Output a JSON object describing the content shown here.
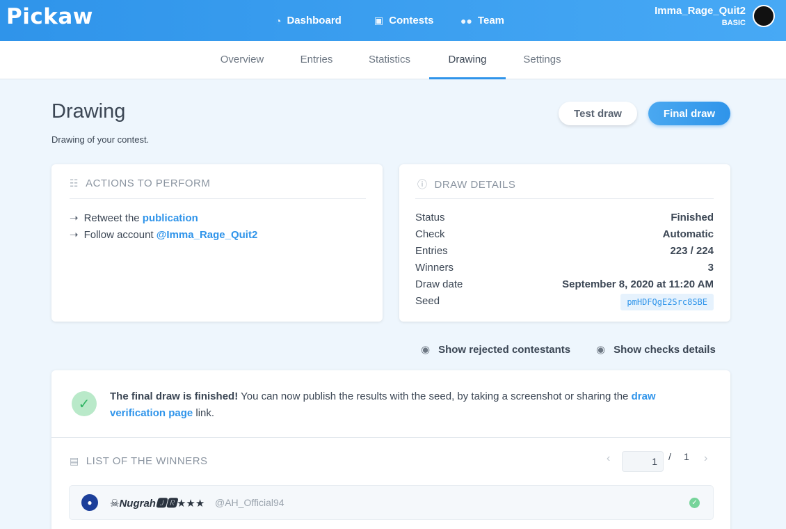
{
  "app": {
    "logo_text": "Pickaw",
    "nav": [
      {
        "label": "Dashboard",
        "icon": "dashboard-icon"
      },
      {
        "label": "Contests",
        "icon": "gift-icon"
      },
      {
        "label": "Team",
        "icon": "team-icon"
      }
    ],
    "user": {
      "name": "Imma_Rage_Quit2",
      "plan": "BASIC"
    }
  },
  "tabs": [
    "Overview",
    "Entries",
    "Statistics",
    "Drawing",
    "Settings"
  ],
  "active_tab": "Drawing",
  "page": {
    "title": "Drawing",
    "subtitle": "Drawing of your contest.",
    "test_draw": "Test draw",
    "final_draw": "Final draw"
  },
  "actions": {
    "title": "ACTIONS TO PERFORM",
    "items": [
      {
        "text": "Retweet the ",
        "link": "publication"
      },
      {
        "text": "Follow account ",
        "link": "@Imma_Rage_Quit2"
      }
    ]
  },
  "details": {
    "title": "DRAW DETAILS",
    "rows": [
      {
        "label": "Status",
        "value": "Finished"
      },
      {
        "label": "Check",
        "value": "Automatic"
      },
      {
        "label": "Entries",
        "value": "223 / 224"
      },
      {
        "label": "Winners",
        "value": "3"
      },
      {
        "label": "Draw date",
        "value": "September 8, 2020 at 11:20 AM"
      },
      {
        "label": "Seed",
        "value": "pmHDFQgE2Src8SBE"
      }
    ]
  },
  "toggles": {
    "rejected": "Show rejected contestants",
    "checks": "Show checks details"
  },
  "notice": {
    "bold": "The final draw is finished!",
    "text": " You can now publish the results with the seed, by taking a screenshot or sharing the ",
    "link": "draw verification page",
    "end": " link."
  },
  "winners": {
    "title": "LIST OF THE WINNERS",
    "page": "1",
    "separator": "/",
    "total_pages": "1",
    "list": [
      {
        "name": "☠Nugrah🅹🆁★★★",
        "handle": "@AH_Official94",
        "verified": true
      }
    ]
  },
  "colors": {
    "accent": "#2f94ea",
    "success": "#2fb463"
  }
}
